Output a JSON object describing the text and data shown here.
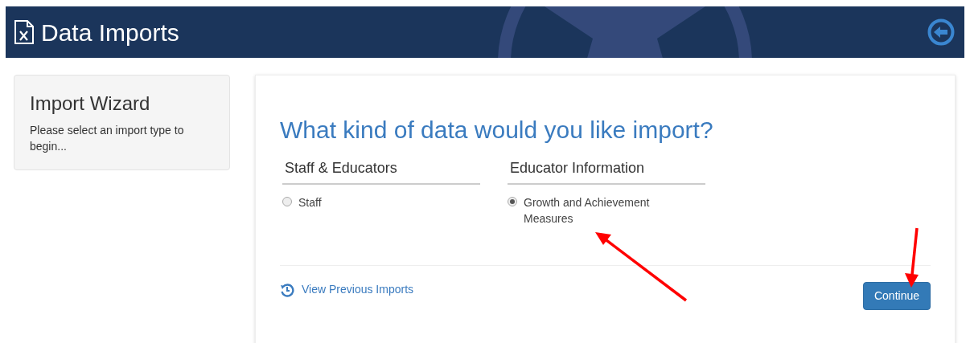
{
  "header": {
    "title": "Data Imports"
  },
  "sidebar": {
    "title": "Import Wizard",
    "text": "Please select an import type to begin..."
  },
  "main": {
    "question": "What kind of data would you like import?",
    "groups": [
      {
        "title": "Staff & Educators",
        "options": [
          {
            "label": "Staff",
            "selected": false
          }
        ]
      },
      {
        "title": "Educator Information",
        "options": [
          {
            "label": "Growth and Achievement Measures",
            "selected": true
          }
        ]
      }
    ],
    "link": "View Previous Imports",
    "button": "Continue"
  }
}
